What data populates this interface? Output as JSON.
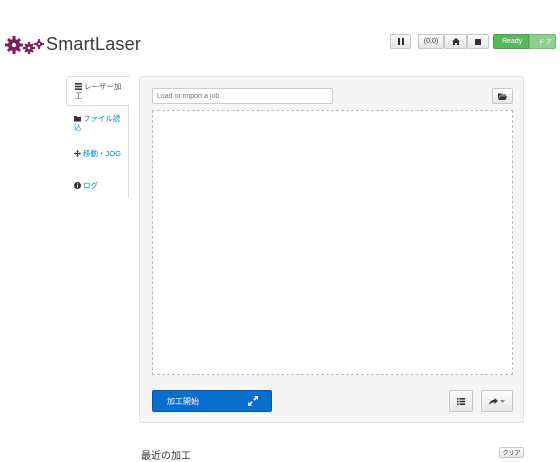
{
  "app": {
    "brand": "SmartLaser"
  },
  "toolbar": {
    "pause_icon": "pause-icon",
    "coords": "(0,0)",
    "home_icon": "home-icon",
    "stop_icon": "stop-icon",
    "status_label": "Ready",
    "door_label": "ドア",
    "status_color": "#5bb75b"
  },
  "sidebar": {
    "items": [
      {
        "icon": "list-icon",
        "label": "レーザー加工"
      },
      {
        "icon": "folder-icon",
        "label": "ファイル読込"
      },
      {
        "icon": "move-icon",
        "label": "移動・JOG"
      },
      {
        "icon": "info-icon",
        "label": "ログ"
      }
    ]
  },
  "main": {
    "job_placeholder": "Load or import a job",
    "start_label": "加工開始",
    "accent": "#0a6ed1"
  },
  "recent": {
    "title": "最近の加工",
    "clear_label": "クリア"
  }
}
